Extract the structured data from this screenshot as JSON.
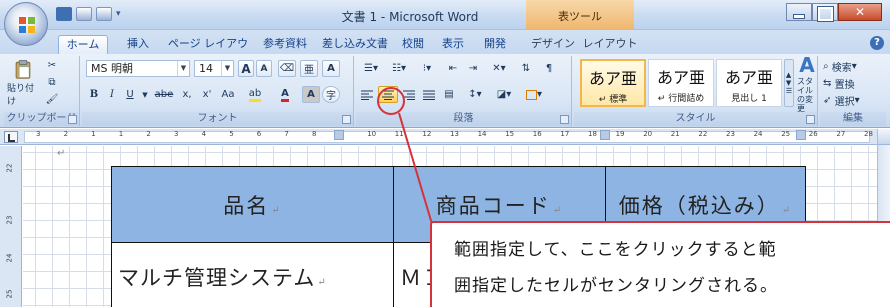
{
  "window": {
    "title": "文書 1 - Microsoft Word",
    "context_tab_group": "表ツール",
    "close_glyph": "✕"
  },
  "tabs": [
    {
      "label": "ホーム",
      "active": true
    },
    {
      "label": "挿入"
    },
    {
      "label": "ページ レイアウト"
    },
    {
      "label": "参考資料"
    },
    {
      "label": "差し込み文書"
    },
    {
      "label": "校閲"
    },
    {
      "label": "表示"
    },
    {
      "label": "開発"
    },
    {
      "label": "デザイン"
    },
    {
      "label": "レイアウト"
    }
  ],
  "help_glyph": "?",
  "ribbon": {
    "clipboard": {
      "label": "クリップボード",
      "paste": "貼り付け"
    },
    "font": {
      "label": "フォント",
      "font_name": "MS 明朝",
      "font_size": "14",
      "bold": "B",
      "italic": "I",
      "underline": "U",
      "strike": "abe",
      "subscript": "x,",
      "superscript": "x'",
      "case": "Aa",
      "grow": "A",
      "shrink": "A"
    },
    "paragraph": {
      "label": "段落"
    },
    "styles": {
      "label": "スタイル",
      "items": [
        {
          "sample": "あア亜",
          "name": "↵ 標準",
          "selected": true
        },
        {
          "sample": "あア亜",
          "name": "↵ 行間詰め"
        },
        {
          "sample": "あア亜",
          "name": "見出し 1"
        }
      ],
      "change_styles": "スタイルの変更"
    },
    "editing": {
      "label": "編集",
      "find": "検索",
      "replace": "置換",
      "select": "選択"
    }
  },
  "ruler": {
    "numbers": [
      "3",
      "2",
      "1",
      "1",
      "2",
      "3",
      "4",
      "5",
      "6",
      "7",
      "8",
      "9",
      "10",
      "11",
      "12",
      "13",
      "14",
      "15",
      "16",
      "17",
      "18",
      "19",
      "20",
      "21",
      "22",
      "23",
      "24",
      "25",
      "26",
      "27",
      "28"
    ]
  },
  "vruler": {
    "numbers": [
      "22",
      "23",
      "24",
      "25"
    ]
  },
  "document": {
    "table": {
      "header": [
        "品名",
        "商品コード",
        "価格（税込み）"
      ],
      "row1": [
        "マルチ管理システム",
        "ＭＩ"
      ]
    },
    "paragraph_mark": "↵"
  },
  "callout": {
    "line1": "範囲指定して、ここをクリックすると範",
    "line2": "囲指定したセルがセンタリングされる。"
  },
  "colors": {
    "header_fill": "#8db4e2",
    "callout_border": "#d6323a",
    "table_tools": "#efb66e"
  }
}
